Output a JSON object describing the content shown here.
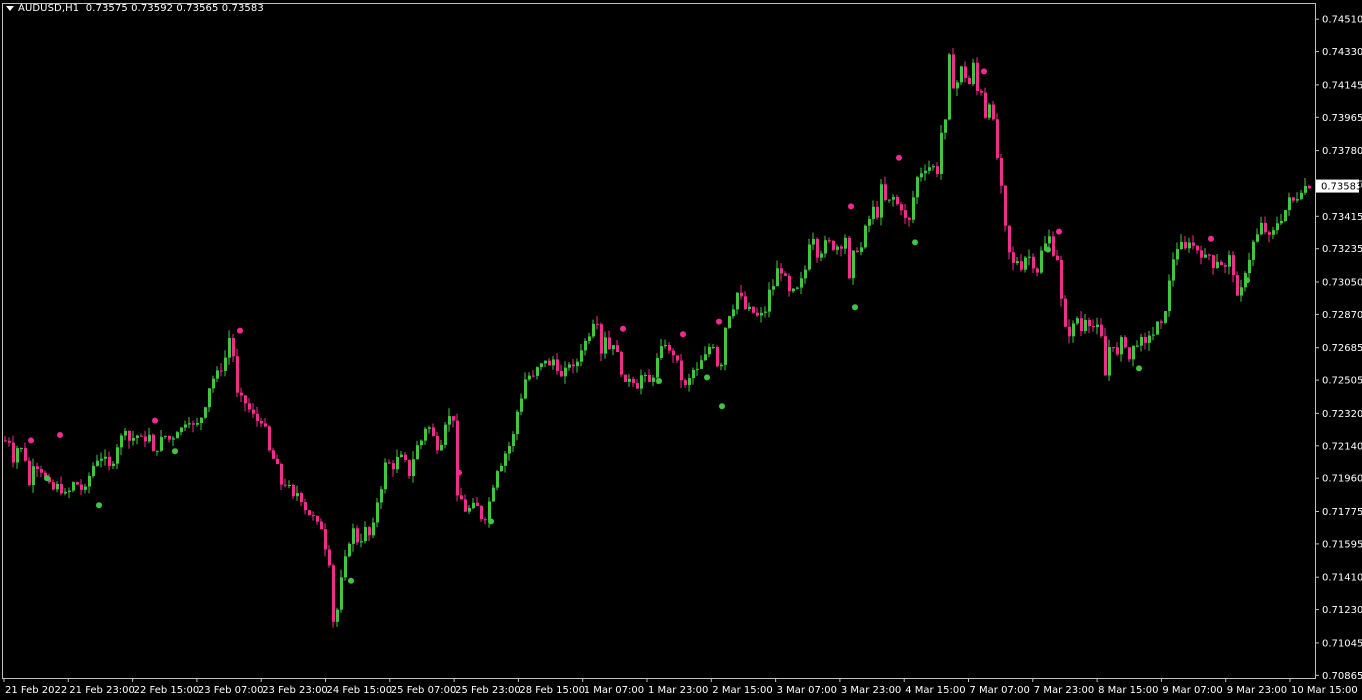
{
  "header": {
    "symbol": "AUDUSD,H1",
    "ohlc": "0.73575 0.73592 0.73565 0.73583",
    "menu_icon": "triangle-down-icon"
  },
  "colors": {
    "background": "#000000",
    "frame": "#c0c0c0",
    "bull": "#43c443",
    "bear": "#ef2d8f",
    "axis_text": "#ffffff",
    "price_tag_bg": "#ffffff",
    "price_tag_text": "#000000"
  },
  "chart_data": {
    "type": "candlestick",
    "symbol": "AUDUSD",
    "timeframe": "H1",
    "last_price": "0.73583",
    "y_axis": {
      "ylim": [
        0.7085,
        0.746
      ],
      "ticks": [
        "0.74510",
        "0.74330",
        "0.74145",
        "0.73965",
        "0.73780",
        "0.73595",
        "0.73415",
        "0.73235",
        "0.73050",
        "0.72870",
        "0.72685",
        "0.72505",
        "0.72320",
        "0.72140",
        "0.71960",
        "0.71775",
        "0.71595",
        "0.71410",
        "0.71230",
        "0.71045",
        "0.70865"
      ]
    },
    "x_axis": {
      "labels": [
        "21 Feb 2022",
        "21 Feb 23:00",
        "22 Feb 15:00",
        "23 Feb 07:00",
        "23 Feb 23:00",
        "24 Feb 15:00",
        "25 Feb 07:00",
        "25 Feb 23:00",
        "28 Feb 15:00",
        "1 Mar 07:00",
        "1 Mar 23:00",
        "2 Mar 15:00",
        "3 Mar 07:00",
        "3 Mar 23:00",
        "4 Mar 15:00",
        "7 Mar 07:00",
        "7 Mar 23:00",
        "8 Mar 15:00",
        "9 Mar 07:00",
        "9 Mar 23:00",
        "10 Mar 15:00"
      ]
    },
    "price_path": [
      [
        0,
        0.7217
      ],
      [
        8,
        0.72165
      ],
      [
        12,
        0.7206
      ],
      [
        16,
        0.7213
      ],
      [
        22,
        0.7212
      ],
      [
        26,
        0.7201
      ],
      [
        28,
        0.7192
      ],
      [
        33,
        0.7207
      ],
      [
        38,
        0.7199
      ],
      [
        40,
        0.72
      ],
      [
        47,
        0.7193
      ],
      [
        53,
        0.7189
      ],
      [
        56,
        0.7192
      ],
      [
        61,
        0.7188
      ],
      [
        65,
        0.7187
      ],
      [
        70,
        0.719
      ],
      [
        73,
        0.7195
      ],
      [
        78,
        0.7191
      ],
      [
        83,
        0.7188
      ],
      [
        87,
        0.7196
      ],
      [
        91,
        0.7201
      ],
      [
        94,
        0.7207
      ],
      [
        98,
        0.7206
      ],
      [
        102,
        0.7209
      ],
      [
        106,
        0.7204
      ],
      [
        110,
        0.72
      ],
      [
        114,
        0.7211
      ],
      [
        118,
        0.7217
      ],
      [
        121,
        0.722
      ],
      [
        125,
        0.7225
      ],
      [
        128,
        0.7217
      ],
      [
        131,
        0.7218
      ],
      [
        135,
        0.722
      ],
      [
        139,
        0.7219
      ],
      [
        142,
        0.7216
      ],
      [
        146,
        0.7219
      ],
      [
        149,
        0.722
      ],
      [
        152,
        0.721
      ],
      [
        155,
        0.7211
      ],
      [
        159,
        0.7217
      ],
      [
        162,
        0.722
      ],
      [
        166,
        0.7219
      ],
      [
        170,
        0.7216
      ],
      [
        174,
        0.7222
      ],
      [
        177,
        0.7223
      ],
      [
        181,
        0.7224
      ],
      [
        184,
        0.7227
      ],
      [
        188,
        0.7228
      ],
      [
        192,
        0.7225
      ],
      [
        196,
        0.7226
      ],
      [
        200,
        0.723
      ],
      [
        203,
        0.7234
      ],
      [
        206,
        0.7242
      ],
      [
        210,
        0.7251
      ],
      [
        214,
        0.7252
      ],
      [
        217,
        0.7256
      ],
      [
        221,
        0.7257
      ],
      [
        224,
        0.7263
      ],
      [
        228,
        0.7274
      ],
      [
        231,
        0.7274
      ],
      [
        234,
        0.7244
      ],
      [
        237,
        0.7242
      ],
      [
        241,
        0.724
      ],
      [
        245,
        0.7237
      ],
      [
        249,
        0.7233
      ],
      [
        252,
        0.7231
      ],
      [
        256,
        0.7228
      ],
      [
        259,
        0.7228
      ],
      [
        263,
        0.7227
      ],
      [
        266,
        0.7216
      ],
      [
        270,
        0.7206
      ],
      [
        273,
        0.7207
      ],
      [
        277,
        0.7201
      ],
      [
        281,
        0.719
      ],
      [
        285,
        0.7194
      ],
      [
        289,
        0.719
      ],
      [
        292,
        0.7185
      ],
      [
        296,
        0.7188
      ],
      [
        300,
        0.7184
      ],
      [
        304,
        0.7179
      ],
      [
        307,
        0.7176
      ],
      [
        311,
        0.7176
      ],
      [
        315,
        0.7169
      ],
      [
        318,
        0.7174
      ],
      [
        322,
        0.7163
      ],
      [
        326,
        0.7152
      ],
      [
        330,
        0.7146
      ],
      [
        333,
        0.7102
      ],
      [
        337,
        0.713
      ],
      [
        341,
        0.7143
      ],
      [
        345,
        0.7154
      ],
      [
        349,
        0.7163
      ],
      [
        353,
        0.7169
      ],
      [
        356,
        0.7161
      ],
      [
        360,
        0.7162
      ],
      [
        364,
        0.7168
      ],
      [
        368,
        0.7164
      ],
      [
        372,
        0.717
      ],
      [
        376,
        0.7183
      ],
      [
        380,
        0.7191
      ],
      [
        384,
        0.7204
      ],
      [
        388,
        0.7204
      ],
      [
        392,
        0.7202
      ],
      [
        396,
        0.7207
      ],
      [
        400,
        0.7208
      ],
      [
        404,
        0.7205
      ],
      [
        408,
        0.7198
      ],
      [
        412,
        0.7207
      ],
      [
        416,
        0.7214
      ],
      [
        420,
        0.7217
      ],
      [
        424,
        0.7224
      ],
      [
        428,
        0.7224
      ],
      [
        432,
        0.7219
      ],
      [
        436,
        0.7213
      ],
      [
        440,
        0.7216
      ],
      [
        444,
        0.7227
      ],
      [
        448,
        0.723
      ],
      [
        452,
        0.7229
      ],
      [
        456,
        0.7185
      ],
      [
        460,
        0.7184
      ],
      [
        464,
        0.7178
      ],
      [
        468,
        0.7179
      ],
      [
        472,
        0.7181
      ],
      [
        476,
        0.718
      ],
      [
        480,
        0.7174
      ],
      [
        484,
        0.7174
      ],
      [
        488,
        0.7183
      ],
      [
        492,
        0.7192
      ],
      [
        496,
        0.7201
      ],
      [
        500,
        0.7204
      ],
      [
        504,
        0.721
      ],
      [
        508,
        0.7214
      ],
      [
        512,
        0.722
      ],
      [
        516,
        0.7233
      ],
      [
        520,
        0.7241
      ],
      [
        524,
        0.7251
      ],
      [
        528,
        0.7253
      ],
      [
        532,
        0.7252
      ],
      [
        536,
        0.7257
      ],
      [
        540,
        0.7259
      ],
      [
        544,
        0.7262
      ],
      [
        548,
        0.7258
      ],
      [
        552,
        0.7262
      ],
      [
        556,
        0.7257
      ],
      [
        560,
        0.7252
      ],
      [
        564,
        0.7256
      ],
      [
        568,
        0.726
      ],
      [
        572,
        0.7257
      ],
      [
        576,
        0.7261
      ],
      [
        580,
        0.7268
      ],
      [
        584,
        0.7272
      ],
      [
        588,
        0.7276
      ],
      [
        592,
        0.7283
      ],
      [
        596,
        0.7283
      ],
      [
        600,
        0.7266
      ],
      [
        604,
        0.7275
      ],
      [
        608,
        0.7268
      ],
      [
        612,
        0.7271
      ],
      [
        616,
        0.7265
      ],
      [
        620,
        0.7255
      ],
      [
        624,
        0.7248
      ],
      [
        628,
        0.7252
      ],
      [
        632,
        0.725
      ],
      [
        636,
        0.7247
      ],
      [
        640,
        0.7253
      ],
      [
        644,
        0.7252
      ],
      [
        648,
        0.7249
      ],
      [
        652,
        0.7253
      ],
      [
        656,
        0.7262
      ],
      [
        660,
        0.7268
      ],
      [
        664,
        0.7271
      ],
      [
        668,
        0.7266
      ],
      [
        672,
        0.7265
      ],
      [
        676,
        0.726
      ],
      [
        680,
        0.7251
      ],
      [
        684,
        0.7247
      ],
      [
        688,
        0.7251
      ],
      [
        692,
        0.7256
      ],
      [
        696,
        0.7256
      ],
      [
        700,
        0.7261
      ],
      [
        704,
        0.7264
      ],
      [
        708,
        0.7269
      ],
      [
        712,
        0.727
      ],
      [
        716,
        0.7259
      ],
      [
        720,
        0.726
      ],
      [
        724,
        0.728
      ],
      [
        728,
        0.7287
      ],
      [
        732,
        0.7291
      ],
      [
        736,
        0.7299
      ],
      [
        740,
        0.7296
      ],
      [
        744,
        0.729
      ],
      [
        748,
        0.729
      ],
      [
        752,
        0.7288
      ],
      [
        756,
        0.7286
      ],
      [
        760,
        0.7287
      ],
      [
        764,
        0.7289
      ],
      [
        768,
        0.73
      ],
      [
        772,
        0.7303
      ],
      [
        776,
        0.7312
      ],
      [
        780,
        0.7311
      ],
      [
        784,
        0.7307
      ],
      [
        788,
        0.7299
      ],
      [
        792,
        0.73
      ],
      [
        796,
        0.7301
      ],
      [
        800,
        0.7306
      ],
      [
        804,
        0.7312
      ],
      [
        808,
        0.7327
      ],
      [
        812,
        0.733
      ],
      [
        816,
        0.732
      ],
      [
        820,
        0.7322
      ],
      [
        824,
        0.7327
      ],
      [
        828,
        0.7327
      ],
      [
        832,
        0.7324
      ],
      [
        836,
        0.7325
      ],
      [
        840,
        0.7325
      ],
      [
        844,
        0.733
      ],
      [
        848,
        0.7306
      ],
      [
        852,
        0.7321
      ],
      [
        856,
        0.7323
      ],
      [
        860,
        0.7324
      ],
      [
        864,
        0.7335
      ],
      [
        868,
        0.734
      ],
      [
        872,
        0.7346
      ],
      [
        876,
        0.7342
      ],
      [
        880,
        0.7358
      ],
      [
        884,
        0.735
      ],
      [
        888,
        0.735
      ],
      [
        892,
        0.7352
      ],
      [
        896,
        0.7348
      ],
      [
        900,
        0.7346
      ],
      [
        904,
        0.734
      ],
      [
        908,
        0.7339
      ],
      [
        912,
        0.7352
      ],
      [
        916,
        0.7363
      ],
      [
        920,
        0.7366
      ],
      [
        924,
        0.7368
      ],
      [
        928,
        0.7369
      ],
      [
        932,
        0.7369
      ],
      [
        936,
        0.7366
      ],
      [
        940,
        0.7388
      ],
      [
        944,
        0.7394
      ],
      [
        948,
        0.743
      ],
      [
        952,
        0.7414
      ],
      [
        956,
        0.7416
      ],
      [
        960,
        0.7424
      ],
      [
        964,
        0.7419
      ],
      [
        968,
        0.7415
      ],
      [
        972,
        0.7426
      ],
      [
        976,
        0.7411
      ],
      [
        980,
        0.7411
      ],
      [
        984,
        0.7397
      ],
      [
        988,
        0.7405
      ],
      [
        992,
        0.7394
      ],
      [
        996,
        0.7374
      ],
      [
        1000,
        0.7357
      ],
      [
        1004,
        0.7335
      ],
      [
        1008,
        0.7321
      ],
      [
        1012,
        0.7315
      ],
      [
        1016,
        0.7317
      ],
      [
        1020,
        0.7313
      ],
      [
        1024,
        0.7319
      ],
      [
        1028,
        0.7319
      ],
      [
        1032,
        0.7314
      ],
      [
        1036,
        0.7311
      ],
      [
        1040,
        0.7322
      ],
      [
        1044,
        0.7326
      ],
      [
        1048,
        0.733
      ],
      [
        1052,
        0.7321
      ],
      [
        1056,
        0.7318
      ],
      [
        1060,
        0.7295
      ],
      [
        1064,
        0.7279
      ],
      [
        1068,
        0.7276
      ],
      [
        1072,
        0.7281
      ],
      [
        1076,
        0.7285
      ],
      [
        1080,
        0.7278
      ],
      [
        1084,
        0.7285
      ],
      [
        1088,
        0.7282
      ],
      [
        1092,
        0.728
      ],
      [
        1096,
        0.728
      ],
      [
        1100,
        0.7274
      ],
      [
        1104,
        0.7253
      ],
      [
        1108,
        0.7269
      ],
      [
        1112,
        0.727
      ],
      [
        1116,
        0.7264
      ],
      [
        1120,
        0.7273
      ],
      [
        1124,
        0.727
      ],
      [
        1128,
        0.7262
      ],
      [
        1132,
        0.7269
      ],
      [
        1136,
        0.7271
      ],
      [
        1140,
        0.7273
      ],
      [
        1144,
        0.727
      ],
      [
        1148,
        0.7276
      ],
      [
        1152,
        0.7276
      ],
      [
        1156,
        0.7282
      ],
      [
        1160,
        0.7281
      ],
      [
        1164,
        0.729
      ],
      [
        1168,
        0.7305
      ],
      [
        1172,
        0.7318
      ],
      [
        1176,
        0.7324
      ],
      [
        1180,
        0.7326
      ],
      [
        1184,
        0.7323
      ],
      [
        1188,
        0.7328
      ],
      [
        1192,
        0.7325
      ],
      [
        1196,
        0.7323
      ],
      [
        1200,
        0.732
      ],
      [
        1204,
        0.7319
      ],
      [
        1208,
        0.732
      ],
      [
        1212,
        0.7314
      ],
      [
        1216,
        0.7317
      ],
      [
        1220,
        0.7315
      ],
      [
        1224,
        0.7313
      ],
      [
        1228,
        0.7319
      ],
      [
        1232,
        0.731
      ],
      [
        1236,
        0.7296
      ],
      [
        1240,
        0.7301
      ],
      [
        1244,
        0.7311
      ],
      [
        1248,
        0.7318
      ],
      [
        1252,
        0.7327
      ],
      [
        1256,
        0.7331
      ],
      [
        1260,
        0.7337
      ],
      [
        1264,
        0.7333
      ],
      [
        1268,
        0.733
      ],
      [
        1272,
        0.7333
      ],
      [
        1276,
        0.7338
      ],
      [
        1280,
        0.734
      ],
      [
        1284,
        0.7345
      ],
      [
        1288,
        0.7351
      ],
      [
        1292,
        0.735
      ],
      [
        1296,
        0.7352
      ],
      [
        1300,
        0.7356
      ],
      [
        1304,
        0.73583
      ]
    ],
    "markers": {
      "up": [
        [
          43,
          0.7196
        ],
        [
          95,
          0.7181
        ],
        [
          171,
          0.7211
        ],
        [
          347,
          0.7139
        ],
        [
          487,
          0.7172
        ],
        [
          655,
          0.725
        ],
        [
          703,
          0.7252
        ],
        [
          718,
          0.7236
        ],
        [
          851,
          0.7291
        ],
        [
          911,
          0.7327
        ],
        [
          1044,
          0.7323
        ],
        [
          1135,
          0.7257
        ],
        [
          1243,
          0.7306
        ]
      ],
      "down": [
        [
          27,
          0.7217
        ],
        [
          56,
          0.722
        ],
        [
          151,
          0.7228
        ],
        [
          236,
          0.7278
        ],
        [
          455,
          0.7199
        ],
        [
          619,
          0.7279
        ],
        [
          679,
          0.7276
        ],
        [
          715,
          0.7283
        ],
        [
          847,
          0.7347
        ],
        [
          895,
          0.7374
        ],
        [
          980,
          0.7422
        ],
        [
          1055,
          0.7333
        ],
        [
          1207,
          0.7329
        ]
      ]
    }
  }
}
